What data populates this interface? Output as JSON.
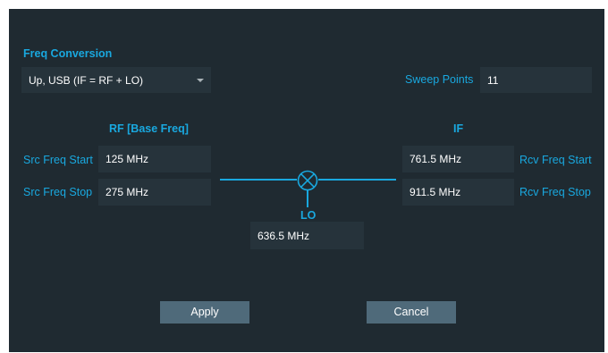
{
  "dialog": {
    "section_title": "Freq Conversion",
    "conversion_mode": "Up, USB (IF = RF + LO)",
    "sweep_points_label": "Sweep Points",
    "sweep_points_value": "11",
    "rf_header": "RF  [Base Freq]",
    "if_header": "IF",
    "lo_label": "LO",
    "src_freq_start_label": "Src Freq Start",
    "src_freq_start_value": "125 MHz",
    "src_freq_stop_label": "Src Freq Stop",
    "src_freq_stop_value": "275 MHz",
    "rcv_freq_start_label": "Rcv Freq Start",
    "rcv_freq_start_value": "761.5 MHz",
    "rcv_freq_stop_label": "Rcv Freq Stop",
    "rcv_freq_stop_value": "911.5 MHz",
    "lo_value": "636.5 MHz",
    "apply_label": "Apply",
    "cancel_label": "Cancel"
  },
  "colors": {
    "background": "#1f2a31",
    "field": "#26333b",
    "accent": "#19a8df",
    "button": "#4f6a7a"
  },
  "icons": {
    "mixer": "mixer-icon",
    "dropdown": "chevron-down-icon"
  }
}
